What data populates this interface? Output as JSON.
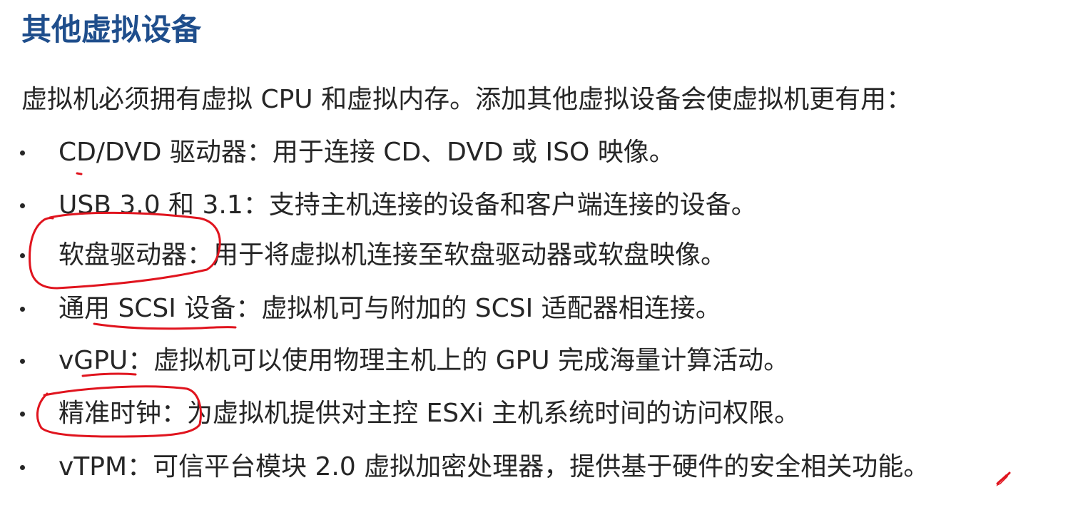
{
  "slide": {
    "title": "其他虚拟设备",
    "intro": "虚拟机必须拥有虚拟 CPU 和虚拟内存。添加其他虚拟设备会使虚拟机更有用：",
    "bullets": [
      "CD/DVD 驱动器：用于连接 CD、DVD 或 ISO 映像。",
      "USB 3.0 和 3.1：支持主机连接的设备和客户端连接的设备。",
      "软盘驱动器：用于将虚拟机连接至软盘驱动器或软盘映像。",
      "通用 SCSI 设备：虚拟机可与附加的 SCSI 适配器相连接。",
      "vGPU：虚拟机可以使用物理主机上的 GPU 完成海量计算活动。",
      "精准时钟：为虚拟机提供对主控 ESXi 主机系统时间的访问权限。",
      "vTPM：可信平台模块 2.0 虚拟加密处理器，提供基于硬件的安全相关功能。"
    ]
  },
  "colors": {
    "title": "#1f4e8c",
    "body_text": "#262626",
    "annotation": "#e0141e",
    "background": "#ffffff"
  }
}
